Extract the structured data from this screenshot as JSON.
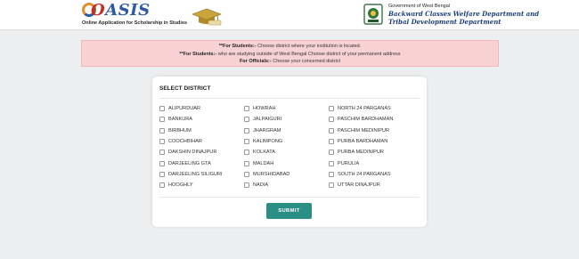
{
  "header": {
    "logo": {
      "word_first": "O",
      "word_rest": "ASIS",
      "tagline": "Online Application for Scholarship in Studies"
    },
    "dept": {
      "gov": "Government of West Bengal",
      "line1": "Backward Classes Welfare Department and",
      "line2": "Tribal Development Department"
    }
  },
  "notice": {
    "line1_label": "**For Students:-",
    "line1_text": " Choose district where your institution is located.",
    "line2_label": "**For Students:-",
    "line2_text": " who are studying outside of West Bengal Choose district of your permanent address",
    "line3_label": "For Officials:-",
    "line3_text": " Choose your concerned district"
  },
  "form": {
    "title": "SELECT DISTRICT",
    "columns": [
      [
        "ALIPURDUAR",
        "BANKURA",
        "BIRBHUM",
        "COOCHBIHAR",
        "DAKSHIN DINAJPUR",
        "DARJEELING GTA",
        "DARJEELING SILIGURI",
        "HOOGHLY"
      ],
      [
        "HOWRAH",
        "JALPAIGURI",
        "JHARGRAM",
        "KALIMPONG",
        "KOLKATA",
        "MALDAH",
        "MURSHIDABAD",
        "NADIA"
      ],
      [
        "NORTH 24 PARGANAS",
        "PASCHIM BARDHAMAN",
        "PASCHIM MEDINIPUR",
        "PURBA BARDHAMAN",
        "PURBA MEDINIPUR",
        "PURULIA",
        "SOUTH 24 PARGANAS",
        "UTTAR DINAJPUR"
      ]
    ],
    "submit_label": "SUBMIT"
  },
  "colors": {
    "accent": "#2b8f85",
    "notice_bg": "#f8d2d3",
    "brand_red": "#d22a1e",
    "brand_blue": "#1f3d7a"
  }
}
